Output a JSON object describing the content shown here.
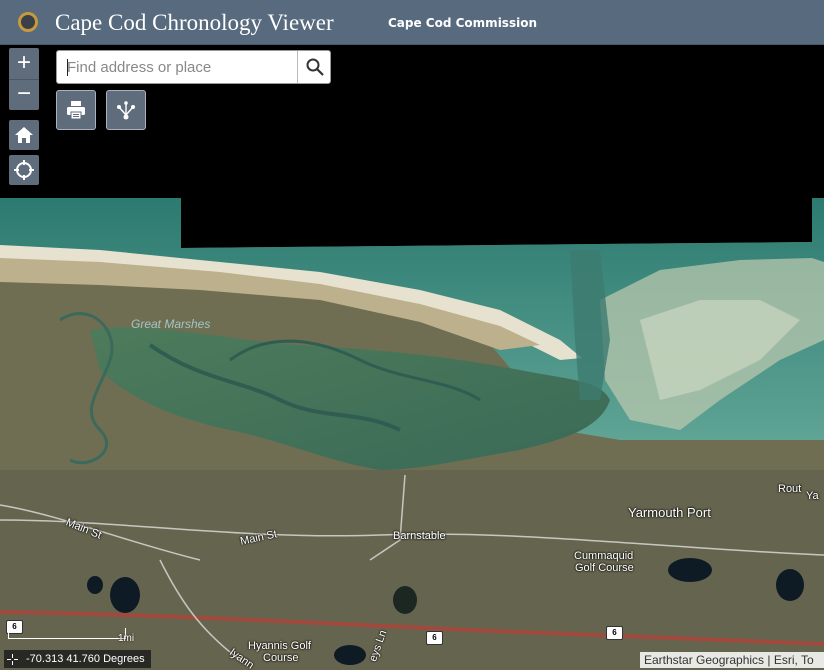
{
  "header": {
    "title": "Cape Cod Chronology Viewer",
    "subtitle": "Cape Cod Commission"
  },
  "search": {
    "placeholder": "Find address or place",
    "value": ""
  },
  "controls": {
    "zoom_in": "+",
    "zoom_out": "−"
  },
  "map_labels": {
    "great_marshes": "Great Marshes",
    "main_st_1": "Main St",
    "main_st_2": "Main St",
    "barnstable": "Barnstable",
    "yarmouth_port": "Yarmouth Port",
    "golf_course_1": "Cummaquid",
    "golf_course_2": "Golf Course",
    "hyannis_1": "Hyannis Golf",
    "hyannis_2": "Course",
    "route": "Rout",
    "route_suffix": "Ya",
    "iyann": "Iyann",
    "eys_ln": "eys Ln",
    "shield_6a": "6",
    "shield_6b": "6",
    "shield_6c": "6"
  },
  "scalebar": {
    "label": "1mi"
  },
  "coordinates": {
    "text": "-70.313 41.760 Degrees"
  },
  "attribution": {
    "text": "Earthstar Geographics | Esri, To"
  }
}
